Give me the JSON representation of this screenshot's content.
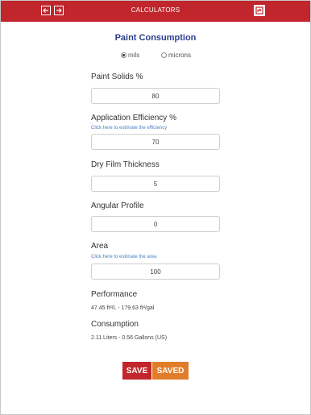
{
  "header": {
    "title": "CALCULATORS",
    "back_icon": "arrow-left-icon",
    "forward_icon": "arrow-right-icon",
    "share_icon": "share-icon",
    "background": "#c0262c"
  },
  "form": {
    "title": "Paint Consumption",
    "units": {
      "options": [
        "mils",
        "microns"
      ],
      "selected": "mils"
    },
    "fields": {
      "paint_solids": {
        "label": "Paint Solids %",
        "value": "80"
      },
      "application_efficiency": {
        "label": "Application Efficiency %",
        "helper": "Click here to estimate the efficiency",
        "value": "70"
      },
      "dry_film_thickness": {
        "label": "Dry Film Thickness",
        "value": "5"
      },
      "angular_profile": {
        "label": "Angular Profile",
        "value": "0"
      },
      "area": {
        "label": "Area",
        "helper": "Click here to estimate the area",
        "value": "100"
      }
    },
    "performance": {
      "label": "Performance",
      "value": "47.45 ft²/L - 179.63 ft²/gal"
    },
    "consumption": {
      "label": "Consumption",
      "value": "2.11 Liters - 0.56 Gallons (US)"
    }
  },
  "actions": {
    "save_label": "SAVE",
    "saved_label": "SAVED",
    "save_color": "#c0262c",
    "saved_color": "#e07d2a"
  }
}
